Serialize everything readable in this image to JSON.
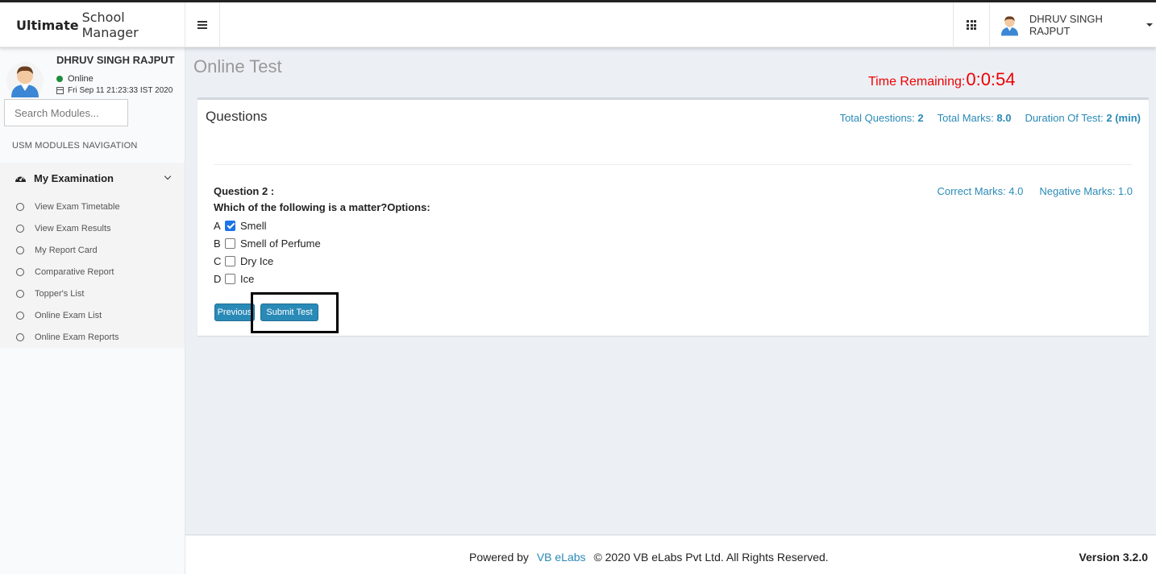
{
  "app": {
    "brand_bold": "Ultimate",
    "brand_rest": "School Manager"
  },
  "header": {
    "user_name": "DHRUV SINGH RAJPUT"
  },
  "sidebar": {
    "user_name": "DHRUV SINGH RAJPUT",
    "status": "Online",
    "datetime": "Fri Sep 11 21:23:33 IST 2020",
    "search_placeholder": "Search Modules...",
    "nav_header": "USM MODULES NAVIGATION",
    "menu_title": "My Examination",
    "items": [
      {
        "label": "View Exam Timetable"
      },
      {
        "label": "View Exam Results"
      },
      {
        "label": "My Report Card"
      },
      {
        "label": "Comparative Report"
      },
      {
        "label": "Topper's List"
      },
      {
        "label": "Online Exam List"
      },
      {
        "label": "Online Exam Reports"
      }
    ]
  },
  "page": {
    "title": "Online Test",
    "timer_label": "Time Remaining:",
    "timer_value": "0:0:54"
  },
  "questions_box": {
    "title": "Questions",
    "total_questions_label": "Total Questions:",
    "total_questions_value": "2",
    "total_marks_label": "Total Marks:",
    "total_marks_value": "8.0",
    "duration_label": "Duration Of Test:",
    "duration_value": "2 (min)"
  },
  "question": {
    "label": "Question 2 :",
    "text": "Which of the following is a matter?Options:",
    "correct_marks": "Correct Marks: 4.0",
    "negative_marks": "Negative Marks: 1.0",
    "options": [
      {
        "letter": "A",
        "text": "Smell",
        "checked": true
      },
      {
        "letter": "B",
        "text": "Smell of Perfume",
        "checked": false
      },
      {
        "letter": "C",
        "text": "Dry Ice",
        "checked": false
      },
      {
        "letter": "D",
        "text": "Ice",
        "checked": false
      }
    ],
    "previous_label": "Previous",
    "submit_label": "Submit Test"
  },
  "footer": {
    "powered_by": "Powered by",
    "company_link": "VB eLabs",
    "copyright": "© 2020 VB eLabs Pvt Ltd. All Rights Reserved.",
    "version": "Version 3.2.0"
  },
  "colors": {
    "accent": "#2a8ab7",
    "timer": "#ee0000",
    "online": "#1c8d3b"
  }
}
